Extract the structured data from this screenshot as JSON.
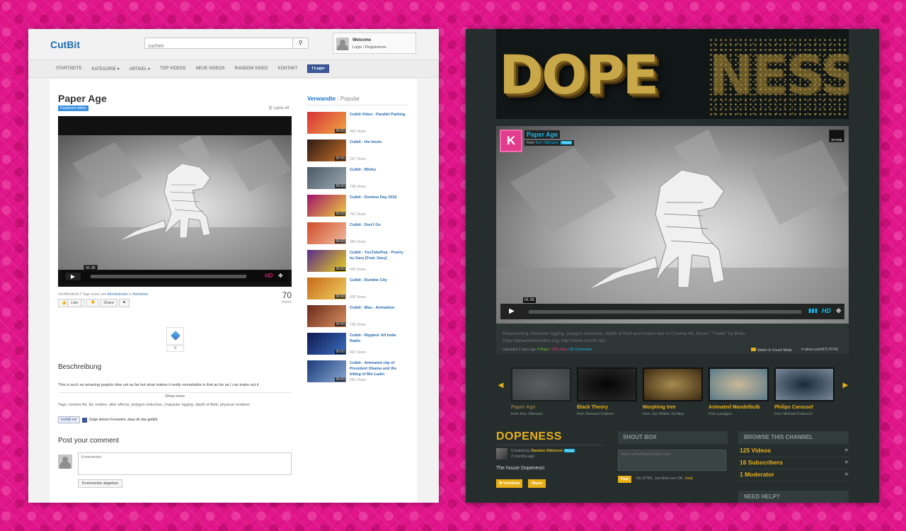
{
  "left": {
    "logo": "CutBit",
    "search_placeholder": "suchen",
    "welcome": {
      "title": "Welcome",
      "links": "Login / Registrieren"
    },
    "nav": [
      "STARTSEITE",
      "KATEGORIE ▾",
      "ARTIKEL ▾",
      "TOP VIDEOS",
      "NEUE VIDEOS",
      "RANDOM VIDEO",
      "KONTAKT"
    ],
    "fb_login": "Login",
    "video": {
      "title": "Paper Age",
      "badge": "Featured video",
      "lights_off": "Lights off",
      "time": "01:35",
      "hd": "HD",
      "meta_prefix": "Veröffentlicht 2 Tage zuvor von",
      "meta_author": "Administrator",
      "meta_in": "in",
      "meta_category": "Animation",
      "views_count": "70",
      "views_label": "Views",
      "buttons": [
        "Like",
        "",
        "Share",
        ""
      ],
      "share_count": "0"
    },
    "beschreibung_heading": "Beschreibung",
    "description": "This is such an amazing graphic idea yet as far but what makes it really remarkable is that as far as I can make out it",
    "show_more": "Show more",
    "tags": "Tags: cinema 4d, 3d, motion, after effects, polygon reduction, character rigging, depth of field, physical renderer",
    "fb_like": "Gefällt mir",
    "fb_like_text": "Zeige deinen Freunden, dass dir das gefällt.",
    "post_heading": "Post your comment",
    "comment_placeholder": "Kommentar",
    "comment_submit": "Kommentar abgeben",
    "related_tab": "Verwandte",
    "popular_tab": "Popular",
    "related": [
      {
        "title": "Cutbit Video - Parallel Parking",
        "views": "469 Views",
        "dur": "00:50",
        "c1": "#d8323a",
        "c2": "#f0a640"
      },
      {
        "title": "Cutbit - the hosts",
        "views": "297 Views",
        "dur": "00:55",
        "c1": "#2b1a14",
        "c2": "#c8702a"
      },
      {
        "title": "Cutbit - Blinky",
        "views": "758 Views",
        "dur": "00:00",
        "c1": "#4a5a66",
        "c2": "#9aa8b0"
      },
      {
        "title": "Cutbit - Domino Day 2010",
        "views": "761 Views",
        "dur": "00:00",
        "c1": "#a0126a",
        "c2": "#f0d040"
      },
      {
        "title": "Cutbit - Don't Go",
        "views": "289 Views",
        "dur": "00:00",
        "c1": "#d04a2a",
        "c2": "#f0c0a0"
      },
      {
        "title": "Cutbit - YouTubePop - Poetry by Gary [Feat. Gary]",
        "views": "430 Views",
        "dur": "00:00",
        "c1": "#5a2a8a",
        "c2": "#e8d020"
      },
      {
        "title": "Cutbit - Rumble City",
        "views": "436 Views",
        "dur": "00:00",
        "c1": "#c86a1a",
        "c2": "#f0d060"
      },
      {
        "title": "Cutbit - Mau - Animation",
        "views": "758 Views",
        "dur": "00:00",
        "c1": "#6a2a1a",
        "c2": "#d89060"
      },
      {
        "title": "Cutbit - Rippled- All India Radio",
        "views": "492 Views",
        "dur": "00:00",
        "c1": "#101850",
        "c2": "#3a70c0"
      },
      {
        "title": "Cutbit - Animated clip of President Obama and the killing of Bin Ladin",
        "views": "582 Views",
        "dur": "00:00",
        "c1": "#1a3a7a",
        "c2": "#8aa8d0"
      }
    ]
  },
  "right": {
    "banner_left": "DOPE",
    "banner_right": "NESS",
    "video": {
      "title": "Paper Age",
      "from_label": "from",
      "author": "Ken Ottmann",
      "plus": "PLUS",
      "share": "SHARE",
      "time": "01:35",
      "hd": "HD"
    },
    "description": "Researching character rigging, polygon reduction, depth of field and motion blur in Cinema 4D. Music: \"Trailer\" by Brian (http://dasanderestelbst.org, http://www.zonoff.net)",
    "uploaded": "Uploaded 3 days ago",
    "plays": "0 Plays",
    "likes": "169 Likes",
    "comments": "25 Comments",
    "couch_mode": "Watch in Couch Mode",
    "vimeo_link": "# vimeo.com/57175742",
    "carousel": [
      {
        "title": "Paper Age",
        "from": "from Ken Ottmann",
        "c1": "#9a9a9a",
        "c2": "#5a5a5a"
      },
      {
        "title": "Black Theory",
        "from": "from Renaud Futterer",
        "c1": "#050505",
        "c2": "#2a2a2a"
      },
      {
        "title": "Morphing tree",
        "from": "from Jan Walter Schliep",
        "c1": "#a88a50",
        "c2": "#3a2a10"
      },
      {
        "title": "Animated Mandelbulb",
        "from": "from juanjgon",
        "c1": "#c8b898",
        "c2": "#5a7a8a"
      },
      {
        "title": "Philips Carousel",
        "from": "from Michael Fakesch",
        "c1": "#1a2a3a",
        "c2": "#7a8a9a"
      }
    ],
    "channel_title": "DOPENESS",
    "created_by_label": "Created by",
    "creator": "Damian Atkinson",
    "creator_badge": "PLUS",
    "created_ago": "2 months ago",
    "channel_desc": "The house Dopeness!",
    "unfollow": "✖ Unfollow",
    "share_btn": "Share",
    "shoutbox_heading": "SHOUT BOX",
    "shoutbox_placeholder": "Write something brilliant here",
    "post_btn": "Post",
    "post_hint": "No HTML, but links are OK.",
    "post_help": "Help",
    "browse_heading": "BROWSE THIS CHANNEL",
    "browse_items": [
      "125 Videos",
      "16 Subscribers",
      "1 Moderator"
    ],
    "need_help": "NEED HELP?"
  }
}
